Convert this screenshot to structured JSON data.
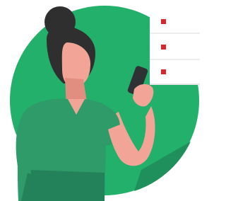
{
  "illustration": {
    "subject": "woman-holding-phone",
    "icons": [
      "list-bullet-icon",
      "list-bullet-icon",
      "list-bullet-icon"
    ]
  },
  "checklist": {
    "item_count": 3,
    "items": [
      "",
      "",
      ""
    ]
  },
  "colors": {
    "background": "#ffffff",
    "circle": "#22b06b",
    "circle_shadow": "#1f8f5c",
    "shirt": "#2e9b68",
    "shirt_shadow": "#23825a",
    "skin": "#f2a596",
    "skin_shadow": "#e18e80",
    "hair": "#2f2f2f",
    "phone": "#2f3235",
    "card": "#ffffff",
    "card_divider": "#d9d9d9",
    "bullet": "#d8262d"
  }
}
